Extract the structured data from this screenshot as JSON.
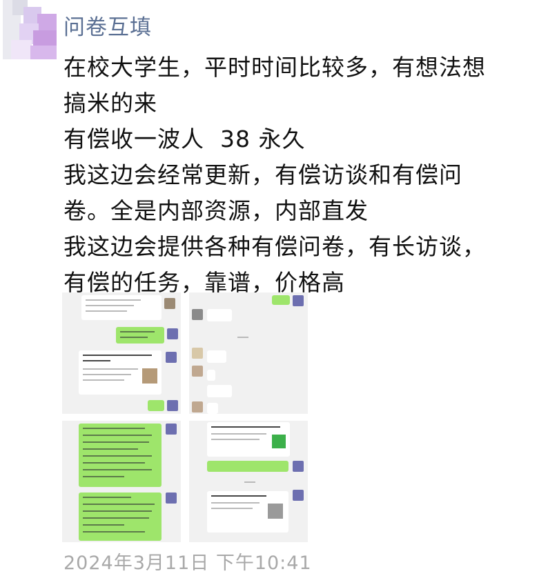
{
  "post": {
    "sender_name": "问卷互填",
    "message_lines": [
      "在校大学生，平时时间比较多，有想法想",
      "搞米的来",
      "有偿收一波人  38 永久",
      "我这边会经常更新，有偿访谈和有偿问",
      "卷。全是内部资源，内部直发",
      "我这边会提供各种有偿问卷，有长访谈，",
      "有偿的任务，靠谱，价格高"
    ],
    "timestamp": "2024年3月11日 下午10:41"
  },
  "images": {
    "count": 4,
    "descriptions": [
      "chat-screenshot-1",
      "chat-screenshot-2",
      "chat-screenshot-3",
      "chat-screenshot-4"
    ]
  },
  "colors": {
    "sender": "#5a6f93",
    "message": "#111111",
    "timestamp": "#a8a8a8",
    "bubble_green": "#9ee56b"
  }
}
